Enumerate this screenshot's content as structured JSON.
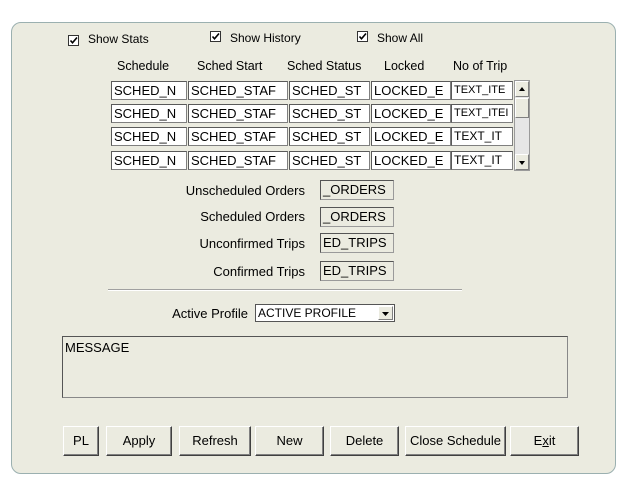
{
  "checkboxes": {
    "show_stats": {
      "label": "Show Stats",
      "checked": true
    },
    "show_history": {
      "label": "Show History",
      "checked": true
    },
    "show_all": {
      "label": "Show All",
      "checked": true
    }
  },
  "grid": {
    "headers": [
      "Schedule",
      "Sched Start",
      "Sched Status",
      "Locked",
      "No of Trip"
    ],
    "rows": [
      [
        "SCHED_N",
        "SCHED_STAF",
        "SCHED_ST",
        "LOCKED_E",
        "TEXT_ITE"
      ],
      [
        "SCHED_N",
        "SCHED_STAF",
        "SCHED_ST",
        "LOCKED_E",
        "TEXT_ITEI"
      ],
      [
        "SCHED_N",
        "SCHED_STAF",
        "SCHED_ST",
        "LOCKED_E",
        "TEXT_IT"
      ],
      [
        "SCHED_N",
        "SCHED_STAF",
        "SCHED_ST",
        "LOCKED_E",
        "TEXT_IT"
      ]
    ]
  },
  "stats": [
    {
      "label": "Unscheduled Orders",
      "value": "_ORDERS"
    },
    {
      "label": "Scheduled Orders",
      "value": "_ORDERS"
    },
    {
      "label": "Unconfirmed Trips",
      "value": "ED_TRIPS"
    },
    {
      "label": "Confirmed Trips",
      "value": "ED_TRIPS"
    }
  ],
  "profile": {
    "label": "Active Profile",
    "value": "ACTIVE  PROFILE"
  },
  "message": "MESSAGE",
  "buttons": {
    "pl": "PL",
    "apply": "Apply",
    "refresh": "Refresh",
    "new": "New",
    "delete": "Delete",
    "close_schedule": "Close Schedule",
    "exit_prefix": "E",
    "exit_mnemonic": "x",
    "exit_suffix": "it"
  }
}
